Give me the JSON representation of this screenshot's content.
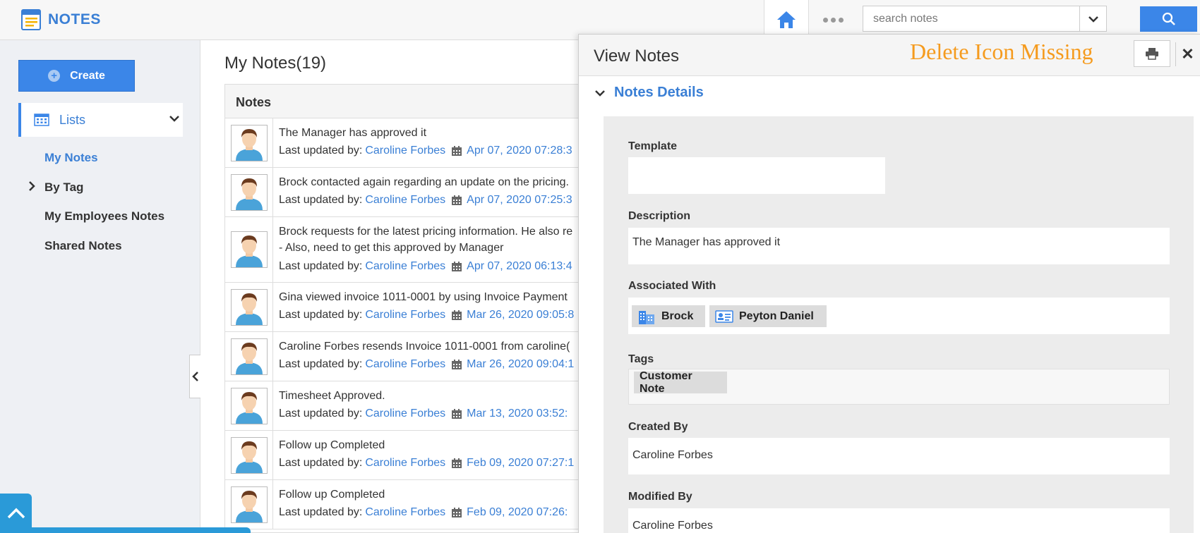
{
  "app": {
    "title": "NOTES"
  },
  "header": {
    "search_placeholder": "search notes"
  },
  "sidebar": {
    "create_label": "Create",
    "lists_label": "Lists",
    "items": [
      {
        "label": "My Notes"
      },
      {
        "label": "By Tag"
      },
      {
        "label": "My Employees Notes"
      },
      {
        "label": "Shared Notes"
      }
    ]
  },
  "main": {
    "title": "My Notes(19)",
    "column": "Notes",
    "updated_prefix": "Last updated by:",
    "notes": [
      {
        "text": "The Manager has approved it",
        "text2": "",
        "by": "Caroline Forbes",
        "date": "Apr 07, 2020 07:28:3"
      },
      {
        "text": "Brock contacted again regarding an update on the pricing.",
        "text2": "",
        "by": "Caroline Forbes",
        "date": "Apr 07, 2020 07:25:3"
      },
      {
        "text": "Brock requests for the latest pricing information. He also re",
        "text2": "- Also, need to get this approved by Manager",
        "by": "Caroline Forbes",
        "date": "Apr 07, 2020 06:13:4"
      },
      {
        "text": "Gina viewed invoice 1011-0001 by using Invoice Payment",
        "text2": "",
        "by": "Caroline Forbes",
        "date": "Mar 26, 2020 09:05:8"
      },
      {
        "text": "Caroline Forbes resends Invoice 1011-0001 from caroline(",
        "text2": "",
        "by": "Caroline Forbes",
        "date": "Mar 26, 2020 09:04:1"
      },
      {
        "text": "Timesheet Approved.",
        "text2": "",
        "by": "Caroline Forbes",
        "date": "Mar 13, 2020 03:52:"
      },
      {
        "text": "Follow up Completed",
        "text2": "",
        "by": "Caroline Forbes",
        "date": "Feb 09, 2020 07:27:1"
      },
      {
        "text": "Follow up Completed",
        "text2": "",
        "by": "Caroline Forbes",
        "date": "Feb 09, 2020 07:26:"
      }
    ]
  },
  "panel": {
    "title": "View Notes",
    "annotation": "Delete Icon Missing",
    "section_title": "Notes Details",
    "fields": {
      "template_label": "Template",
      "template_value": "",
      "description_label": "Description",
      "description_value": "The Manager has approved it",
      "associated_label": "Associated With",
      "associated": [
        "Brock",
        "Peyton Daniel"
      ],
      "tags_label": "Tags",
      "tags": [
        "Customer Note"
      ],
      "created_label": "Created By",
      "created_value": "Caroline Forbes",
      "modified_label": "Modified By",
      "modified_value": "Caroline Forbes"
    }
  },
  "colors": {
    "accent": "#3b86e8",
    "link": "#3a7fd5",
    "annotation": "#f59b1e",
    "scroll_button": "#2a9ad8"
  },
  "icons": {
    "brand": "notepad-icon",
    "home": "home-icon",
    "more": "more-dots-icon",
    "search": "search-icon",
    "lists": "calendar-grid-icon",
    "print": "printer-icon",
    "close": "close-icon",
    "account": "building-icon",
    "contact": "contact-card-icon",
    "date": "calendar-icon",
    "avatar": "user-avatar-icon"
  }
}
